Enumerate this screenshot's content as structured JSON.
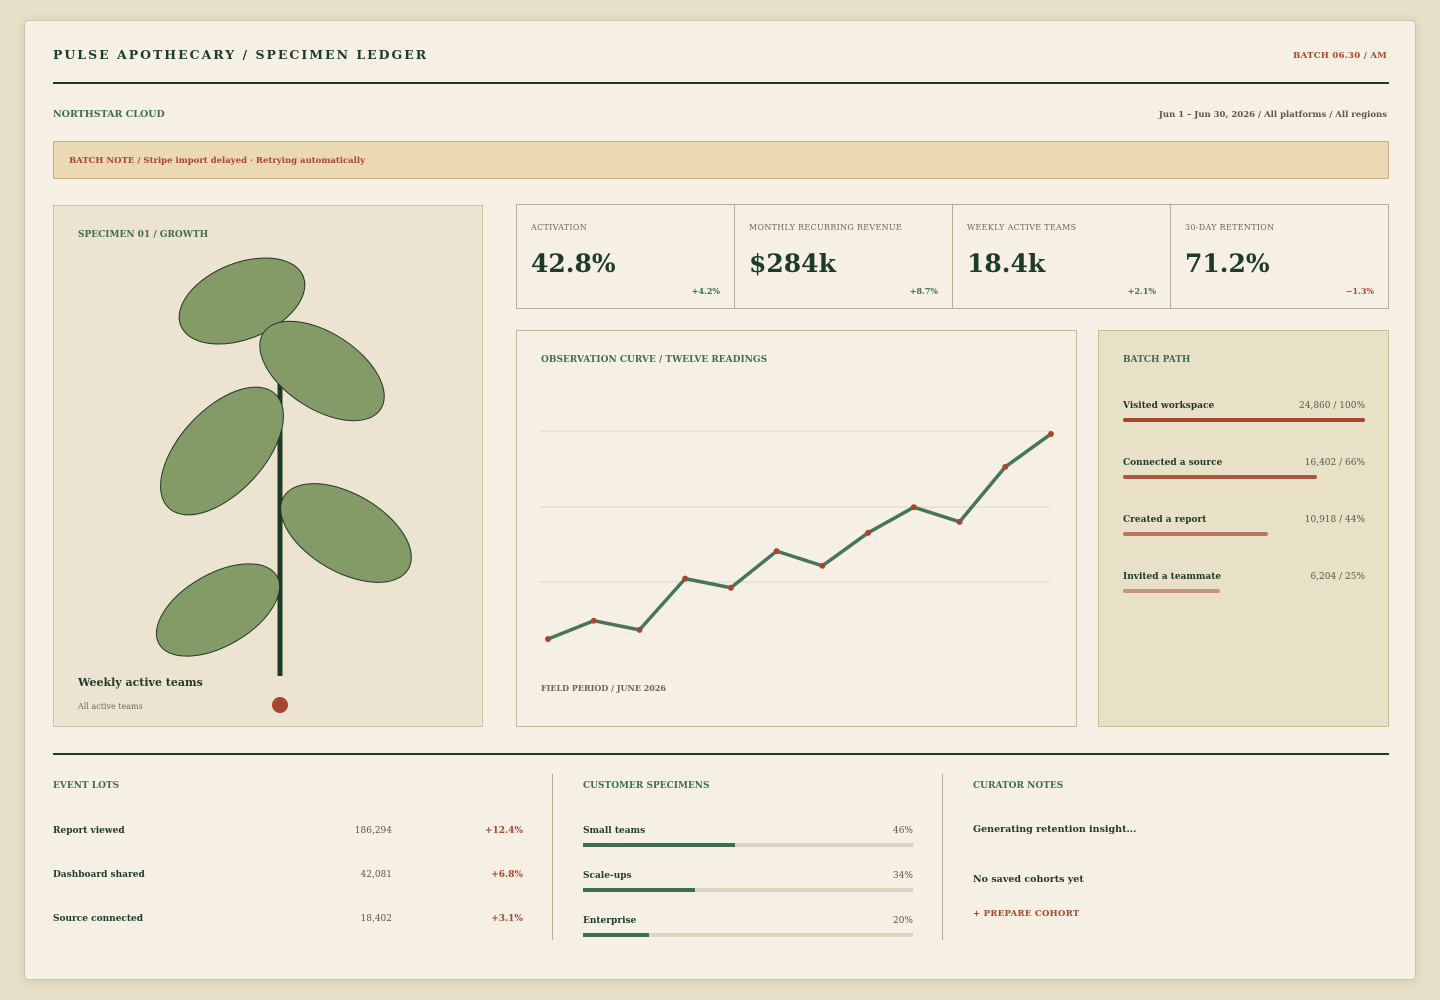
{
  "header": {
    "brand": "PULSE APOTHECARY / SPECIMEN LEDGER",
    "batch": "BATCH 06.30 / AM"
  },
  "filters": {
    "organization": "NORTHSTAR CLOUD",
    "range": "Jun 1 – Jun 30, 2026 / All platforms / All regions"
  },
  "notice": "BATCH NOTE / Stripe import delayed · Retrying automatically",
  "specimen": {
    "label": "SPECIMEN 01 / GROWTH",
    "title": "Weekly active teams",
    "subtitle": "All active teams",
    "leaf_color": "#849a67",
    "stem_color": "#1e3a28",
    "dot_color": "#a8452f"
  },
  "kpis": [
    {
      "label": "ACTIVATION",
      "value": "42.8%",
      "delta": "+4.2%",
      "trend": "up"
    },
    {
      "label": "MONTHLY RECURRING REVENUE",
      "value": "$284k",
      "delta": "+8.7%",
      "trend": "up"
    },
    {
      "label": "WEEKLY ACTIVE TEAMS",
      "value": "18.4k",
      "delta": "+2.1%",
      "trend": "up"
    },
    {
      "label": "30-DAY RETENTION",
      "value": "71.2%",
      "delta": "−1.3%",
      "trend": "down"
    }
  ],
  "curve": {
    "label": "OBSERVATION CURVE / TWELVE READINGS",
    "footer": "FIELD PERIOD / JUNE 2026",
    "line_color": "#477559",
    "point_color": "#a8452f"
  },
  "chart_data": {
    "type": "line",
    "x": [
      1,
      2,
      3,
      4,
      5,
      6,
      7,
      8,
      9,
      10,
      11,
      12
    ],
    "series": [
      {
        "values": [
          12,
          22,
          17,
          45,
          40,
          60,
          52,
          70,
          84,
          76,
          106,
          124
        ]
      }
    ],
    "ylim": [
      0,
      142
    ],
    "grid": true
  },
  "batch_path": {
    "label": "BATCH PATH",
    "steps": [
      {
        "name": "Visited workspace",
        "value": "24,860 / 100%",
        "pct": 100,
        "color": "#a8452f"
      },
      {
        "name": "Connected a source",
        "value": "16,402 / 66%",
        "pct": 80,
        "color": "#b0553d"
      },
      {
        "name": "Created a report",
        "value": "10,918 / 44%",
        "pct": 60,
        "color": "#bc7660"
      },
      {
        "name": "Invited a teammate",
        "value": "6,204 / 25%",
        "pct": 40,
        "color": "#c79280"
      }
    ]
  },
  "event_lots": {
    "label": "EVENT LOTS",
    "rows": [
      {
        "name": "Report viewed",
        "count": "186,294",
        "delta": "+12.4%"
      },
      {
        "name": "Dashboard shared",
        "count": "42,081",
        "delta": "+6.8%"
      },
      {
        "name": "Source connected",
        "count": "18,402",
        "delta": "+3.1%"
      }
    ]
  },
  "customer_specimens": {
    "label": "CUSTOMER SPECIMENS",
    "rows": [
      {
        "name": "Small teams",
        "pct_label": "46%",
        "pct": 46
      },
      {
        "name": "Scale-ups",
        "pct_label": "34%",
        "pct": 34
      },
      {
        "name": "Enterprise",
        "pct_label": "20%",
        "pct": 20
      }
    ]
  },
  "curator_notes": {
    "label": "CURATOR NOTES",
    "status": "Generating retention insight...",
    "empty": "No saved cohorts yet",
    "cta": "+ PREPARE COHORT"
  }
}
